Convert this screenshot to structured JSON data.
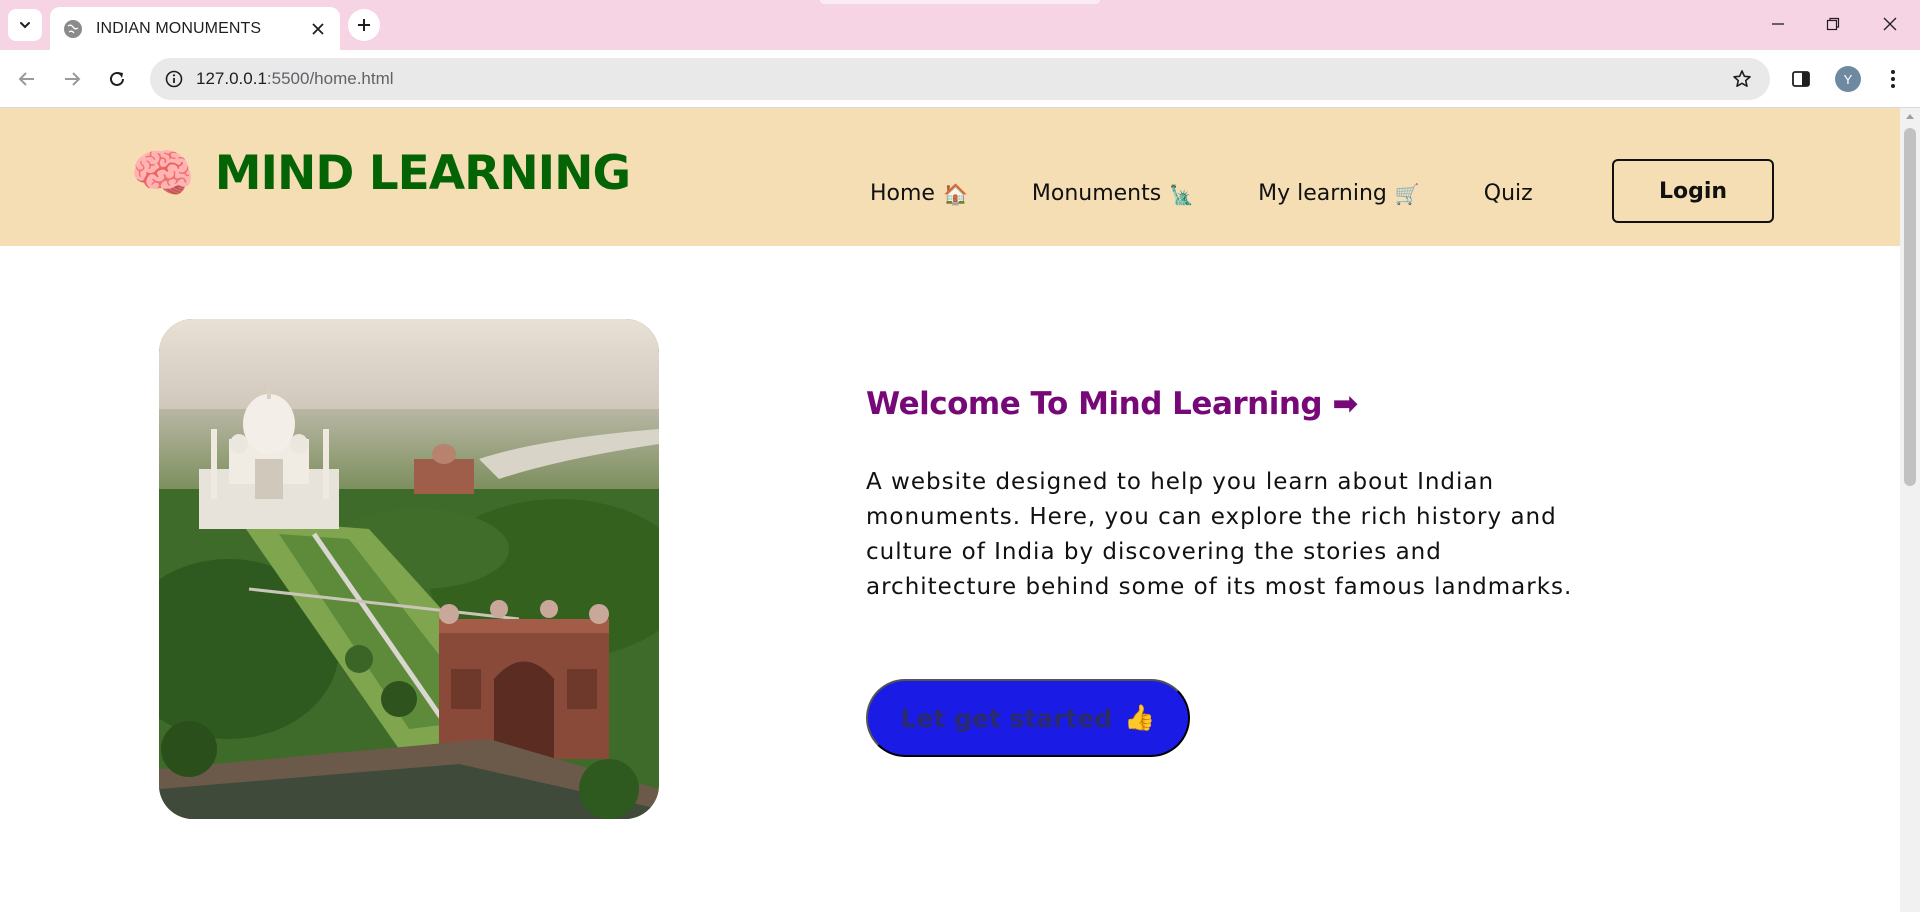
{
  "browser": {
    "tab_title": "INDIAN MONUMENTS",
    "url_host": "127.0.0.1",
    "url_path": ":5500/home.html",
    "profile_initial": "Y"
  },
  "header": {
    "brand_icon": "🧠",
    "brand": "MIND LEARNING",
    "nav": [
      {
        "label": "Home",
        "emoji": "🏠"
      },
      {
        "label": "Monuments",
        "emoji": "🗽"
      },
      {
        "label": "My learning",
        "emoji": "🛒"
      },
      {
        "label": "Quiz",
        "emoji": ""
      }
    ],
    "login": "Login"
  },
  "hero": {
    "heading": "Welcome To Mind Learning ➡",
    "description": "A website designed to help you learn about Indian monuments. Here, you can explore the rich history and culture of India by discovering the stories and architecture behind some of its most famous landmarks.",
    "cta_label": "Let get started",
    "cta_emoji": "👍"
  },
  "colors": {
    "tabstrip": "#f6d4e4",
    "header_bg": "#f5deb3",
    "brand": "#046405",
    "heading": "#770877",
    "cta_bg": "#1b1be6"
  }
}
